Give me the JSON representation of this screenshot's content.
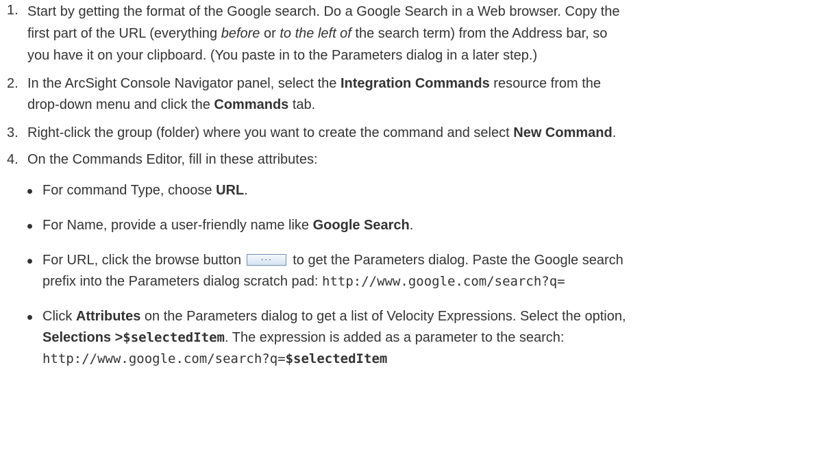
{
  "steps": [
    {
      "number": "1.",
      "line1_a": "Start by getting the format of the Google search. Do a Google Search in a Web browser. Copy the",
      "line2_a": "first part of the URL (everything ",
      "line2_em1": "before",
      "line2_b": " or ",
      "line2_em2": "to the left of",
      "line2_c": " the search term) from the Address bar, so",
      "line3": "you have it on your clipboard. (You paste in to the Parameters dialog in a later step.)"
    },
    {
      "number": "2.",
      "line1_a": "In the ArcSight Console Navigator panel, select the ",
      "line1_b": "Integration Commands",
      "line1_c": " resource from the",
      "line2_a": "drop-down menu and click the ",
      "line2_b": "Commands",
      "line2_c": " tab."
    },
    {
      "number": "3.",
      "text_a": "Right-click the group (folder) where you want to create the command and select ",
      "text_b": "New Command",
      "text_c": "."
    },
    {
      "number": "4.",
      "text": "On the Commands Editor, fill in these attributes:"
    }
  ],
  "bullets": {
    "b1_a": "For command Type, choose ",
    "b1_b": "URL",
    "b1_c": ".",
    "b2_a": "For Name, provide a user-friendly name like ",
    "b2_b": "Google Search",
    "b2_c": ".",
    "b3_a": "For URL, click the browse button ",
    "b3_button": "···",
    "b3_b": " to get the Parameters dialog. Paste the Google search",
    "b3_c": "prefix into the Parameters dialog scratch pad: ",
    "b3_code": "http://www.google.com/search?q=",
    "b4_a": "Click ",
    "b4_b": "Attributes",
    "b4_c": " on the Parameters dialog to get a list of Velocity Expressions. Select the option,",
    "b4_d": "Selections >",
    "b4_e": "$selectedItem",
    "b4_f": ". The expression is added as a parameter to the search:",
    "b4_code": "http://www.google.com/search?q=",
    "b4_code_bold": "$selectedItem"
  }
}
